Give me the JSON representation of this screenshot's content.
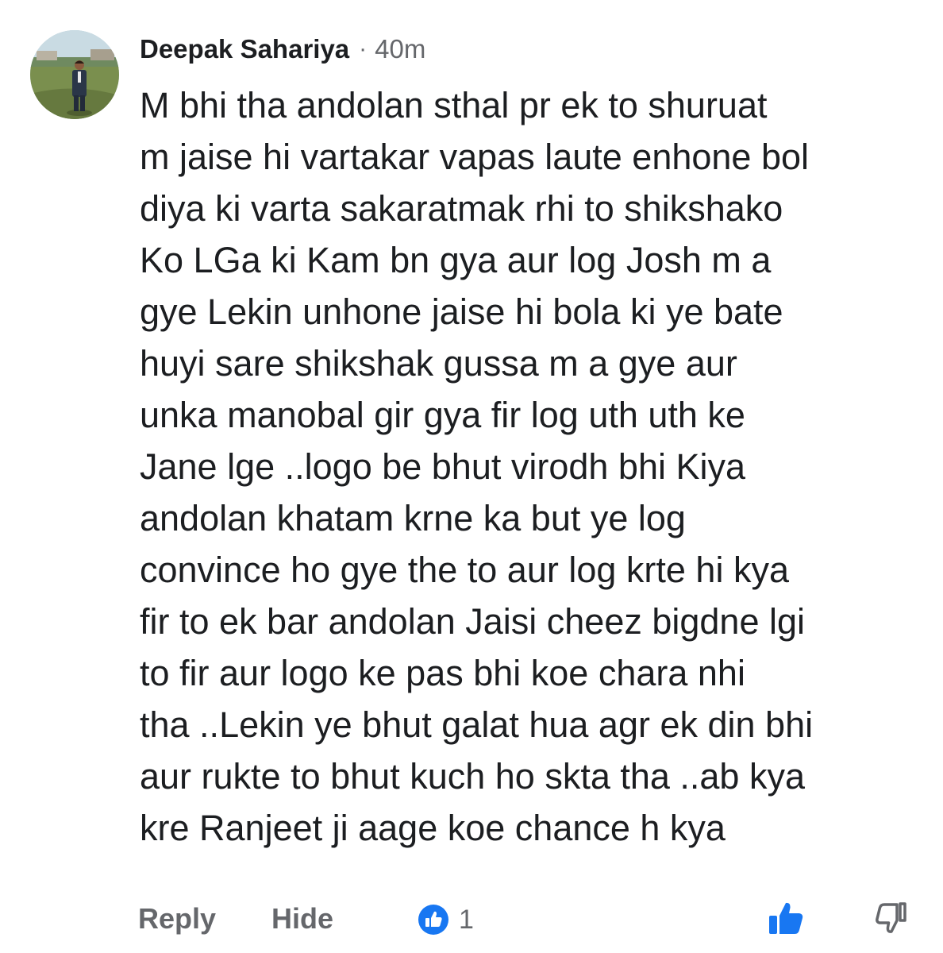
{
  "comment": {
    "author": "Deepak Sahariya",
    "separator": "·",
    "time": "40m",
    "lines": [
      "M bhi tha andolan sthal pr ek to shuruat",
      "m jaise hi vartakar vapas laute enhone bol",
      "diya ki varta sakaratmak rhi to shikshako",
      "Ko LGa ki Kam bn gya aur log Josh m a",
      "gye Lekin unhone jaise hi bola ki ye bate",
      "huyi sare shikshak gussa m a gye aur",
      "unka manobal gir gya fir log uth uth ke",
      "Jane lge ..logo be bhut virodh bhi Kiya",
      "andolan khatam krne ka but ye log",
      "convince ho gye the to aur log krte hi kya",
      "fir to ek bar andolan Jaisi cheez bigdne lgi",
      "to fir aur logo ke pas bhi koe chara nhi",
      "tha ..Lekin ye bhut galat hua agr ek din bhi",
      "aur rukte to bhut kuch ho skta tha ..ab kya",
      "kre Ranjeet ji aage koe chance h kya"
    ]
  },
  "actions": {
    "reply_label": "Reply",
    "hide_label": "Hide",
    "reaction_count": "1",
    "reaction_icon": "like-reaction-icon",
    "like_icon": "thumbs-up-icon",
    "dislike_icon": "thumbs-down-icon"
  },
  "colors": {
    "text_primary": "#1c1e21",
    "text_secondary": "#65676b",
    "like_blue": "#1877f2"
  }
}
